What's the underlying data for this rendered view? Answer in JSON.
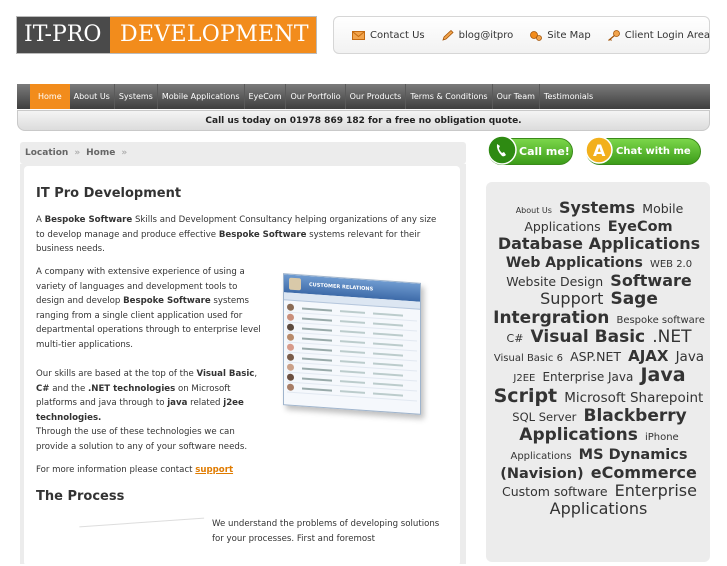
{
  "logo": {
    "left": "IT-PRO",
    "right": "DEVELOPMENT"
  },
  "toplinks": [
    {
      "label": "Contact Us",
      "icon": "envelope-icon"
    },
    {
      "label": "blog@itpro",
      "icon": "pencil-icon"
    },
    {
      "label": "Site Map",
      "icon": "sitemap-icon"
    },
    {
      "label": "Client Login Area",
      "icon": "key-icon"
    }
  ],
  "nav": [
    "Home",
    "About Us",
    "Systems",
    "Mobile Applications",
    "EyeCom",
    "Our Portfolio",
    "Our Products",
    "Terms & Conditions",
    "Our Team",
    "Testimonials"
  ],
  "callbar": "Call us today on 01978 869 182 for a free no obligation quote.",
  "location": {
    "label": "Location",
    "home": "Home"
  },
  "buttons": {
    "call": "Call me!",
    "chat": "Chat with me"
  },
  "main": {
    "title": "IT Pro Development",
    "p1": {
      "a": "A ",
      "b1": "Bespoke Software",
      "c": " Skills and Development Consultancy helping organizations of any size to develop manage and produce effective ",
      "b2": "Bespoke Software",
      "d": " systems relevant for their business needs."
    },
    "p2": {
      "a": "A company with extensive experience of using a variety of languages and development tools to design and develop ",
      "b": "Bespoke Software",
      "c": " systems ranging from a single client application used for departmental operations through to enterprise level multi-tier applications."
    },
    "p3": {
      "a": "Our skills are based at the top of the ",
      "b1": "Visual Basic",
      "c": ", ",
      "b2": "C#",
      "d": " and the ",
      "b3": ".NET technologies",
      "e": " on Microsoft platforms and java through to ",
      "b4": "java",
      "f": " related ",
      "b5": "j2ee technologies.",
      "g": "Through the use of these technologies we can provide a solution to any of your software needs."
    },
    "p4": {
      "a": "For more information please contact ",
      "link": "support"
    },
    "h2": "The Process",
    "p5": "We understand the problems of developing solutions for your processes.  First and foremost",
    "screenshot": {
      "title": "CUSTOMER RELATIONS"
    }
  },
  "cloud": [
    {
      "t": "About Us",
      "s": 8
    },
    {
      "t": "Systems",
      "s": 16
    },
    {
      "t": "Mobile Applications",
      "s": 12.5
    },
    {
      "t": "EyeCom",
      "s": 14.5
    },
    {
      "t": "Database Applications",
      "s": 16
    },
    {
      "t": "Web Applications",
      "s": 14
    },
    {
      "t": "WEB 2.0",
      "s": 10
    },
    {
      "t": "Website Design",
      "s": 12.5
    },
    {
      "t": "Software",
      "s": 16
    },
    {
      "t": "Support",
      "s": 16
    },
    {
      "t": "Sage",
      "s": 17
    },
    {
      "t": "Intergration",
      "s": 17
    },
    {
      "t": "Bespoke software",
      "s": 10
    },
    {
      "t": "C#",
      "s": 11
    },
    {
      "t": "Visual Basic",
      "s": 17
    },
    {
      "t": ".NET",
      "s": 17
    },
    {
      "t": "Visual Basic 6",
      "s": 10
    },
    {
      "t": "ASP.NET",
      "s": 12.5
    },
    {
      "t": "AJAX",
      "s": 15
    },
    {
      "t": "Java",
      "s": 13.5
    },
    {
      "t": "J2EE",
      "s": 10
    },
    {
      "t": "Enterprise Java",
      "s": 12
    },
    {
      "t": "Java Script",
      "s": 19
    },
    {
      "t": "Microsoft Sharepoint",
      "s": 13.5
    },
    {
      "t": "SQL Server",
      "s": 11.5
    },
    {
      "t": "Blackberry Applications",
      "s": 17
    },
    {
      "t": "iPhone Applications",
      "s": 10
    },
    {
      "t": "MS Dynamics (Navision)",
      "s": 14.5
    },
    {
      "t": "eCommerce",
      "s": 16
    },
    {
      "t": "Custom software",
      "s": 12.5
    },
    {
      "t": "Enterprise Applications",
      "s": 16
    }
  ],
  "colors": {
    "orange": "#f28c1c",
    "green": "#3c9c19",
    "dark": "#4a4a4a"
  }
}
